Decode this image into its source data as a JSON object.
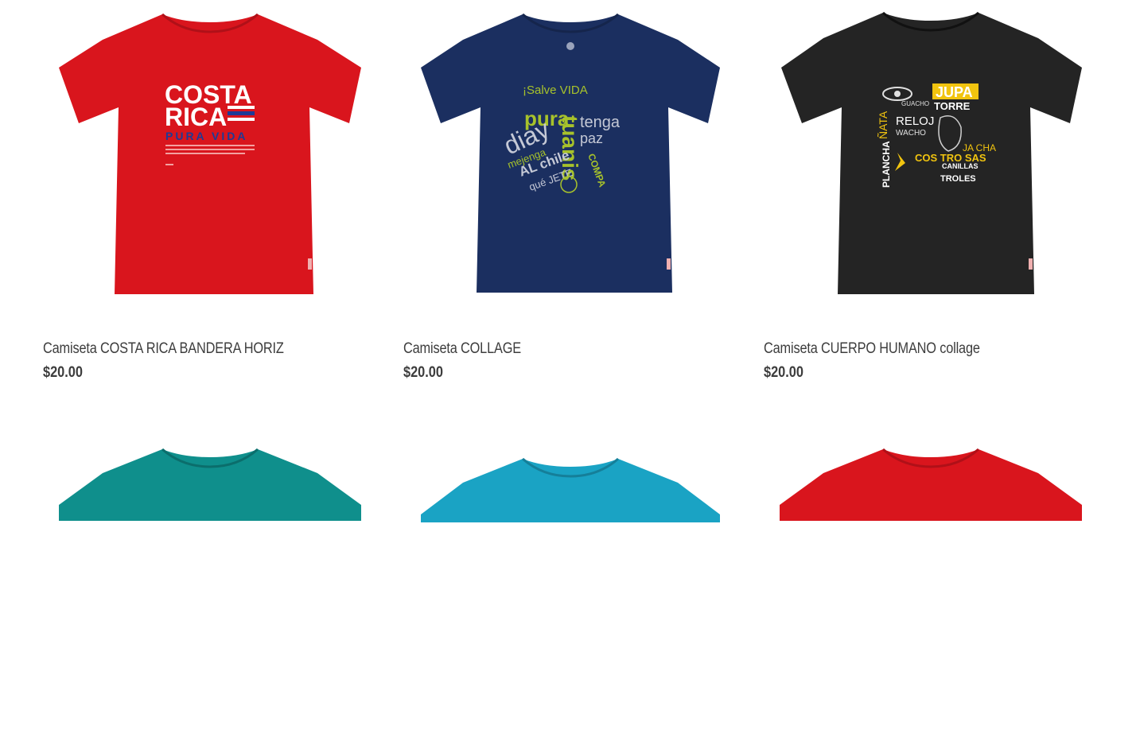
{
  "products": [
    {
      "title": "Camiseta COSTA RICA BANDERA HORIZ",
      "price": "$20.00",
      "shirt_color": "#d9151d",
      "print": {
        "line1": "COSTA",
        "line2": "RICA",
        "line3": "PURA VIDA"
      }
    },
    {
      "title": "Camiseta COLLAGE",
      "price": "$20.00",
      "shirt_color": "#1b2f60",
      "print": {
        "words": [
          "pura",
          "tuanis",
          "diay",
          "tenga",
          "paz",
          "mejenga",
          "AL chile",
          "qué JETE",
          "COMPA",
          "¡Salve VIDA"
        ]
      }
    },
    {
      "title": "Camiseta CUERPO HUMANO collage",
      "price": "$20.00",
      "shirt_color": "#242424",
      "print": {
        "words": [
          "JUPA",
          "TORRE",
          "GUACHO",
          "RELOJ",
          "WACHO",
          "ÑATA",
          "PLANCHA",
          "COS TRO SAS",
          "JA CHA",
          "CANILLAS",
          "TROLES"
        ]
      }
    }
  ],
  "row2": [
    {
      "shirt_color": "#0f8f8c"
    },
    {
      "shirt_color": "#1aa3c4"
    },
    {
      "shirt_color": "#d9151d"
    }
  ]
}
